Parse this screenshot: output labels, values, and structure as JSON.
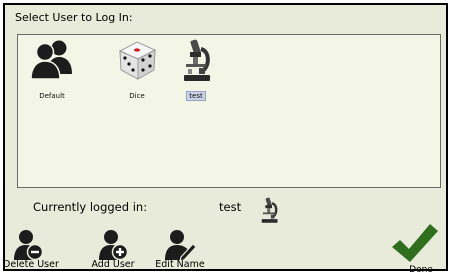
{
  "dialog": {
    "title": "Select User to Log In:"
  },
  "users": [
    {
      "name": "Default",
      "icon": "users-icon"
    },
    {
      "name": "Dice",
      "icon": "dice-icon"
    },
    {
      "name": "test",
      "icon": "microscope-icon",
      "selected": true
    }
  ],
  "status": {
    "label": "Currently logged in:",
    "current_user": "test",
    "current_icon": "microscope-icon"
  },
  "actions": {
    "delete_label": "Delete User",
    "add_label": "Add User",
    "edit_label": "Edit Name",
    "done_label": "Done"
  },
  "colors": {
    "background": "#e8ebd9",
    "list_background": "#f3f5e6",
    "checkmark": "#2f6e1c",
    "selection": "#cdd3e6"
  }
}
